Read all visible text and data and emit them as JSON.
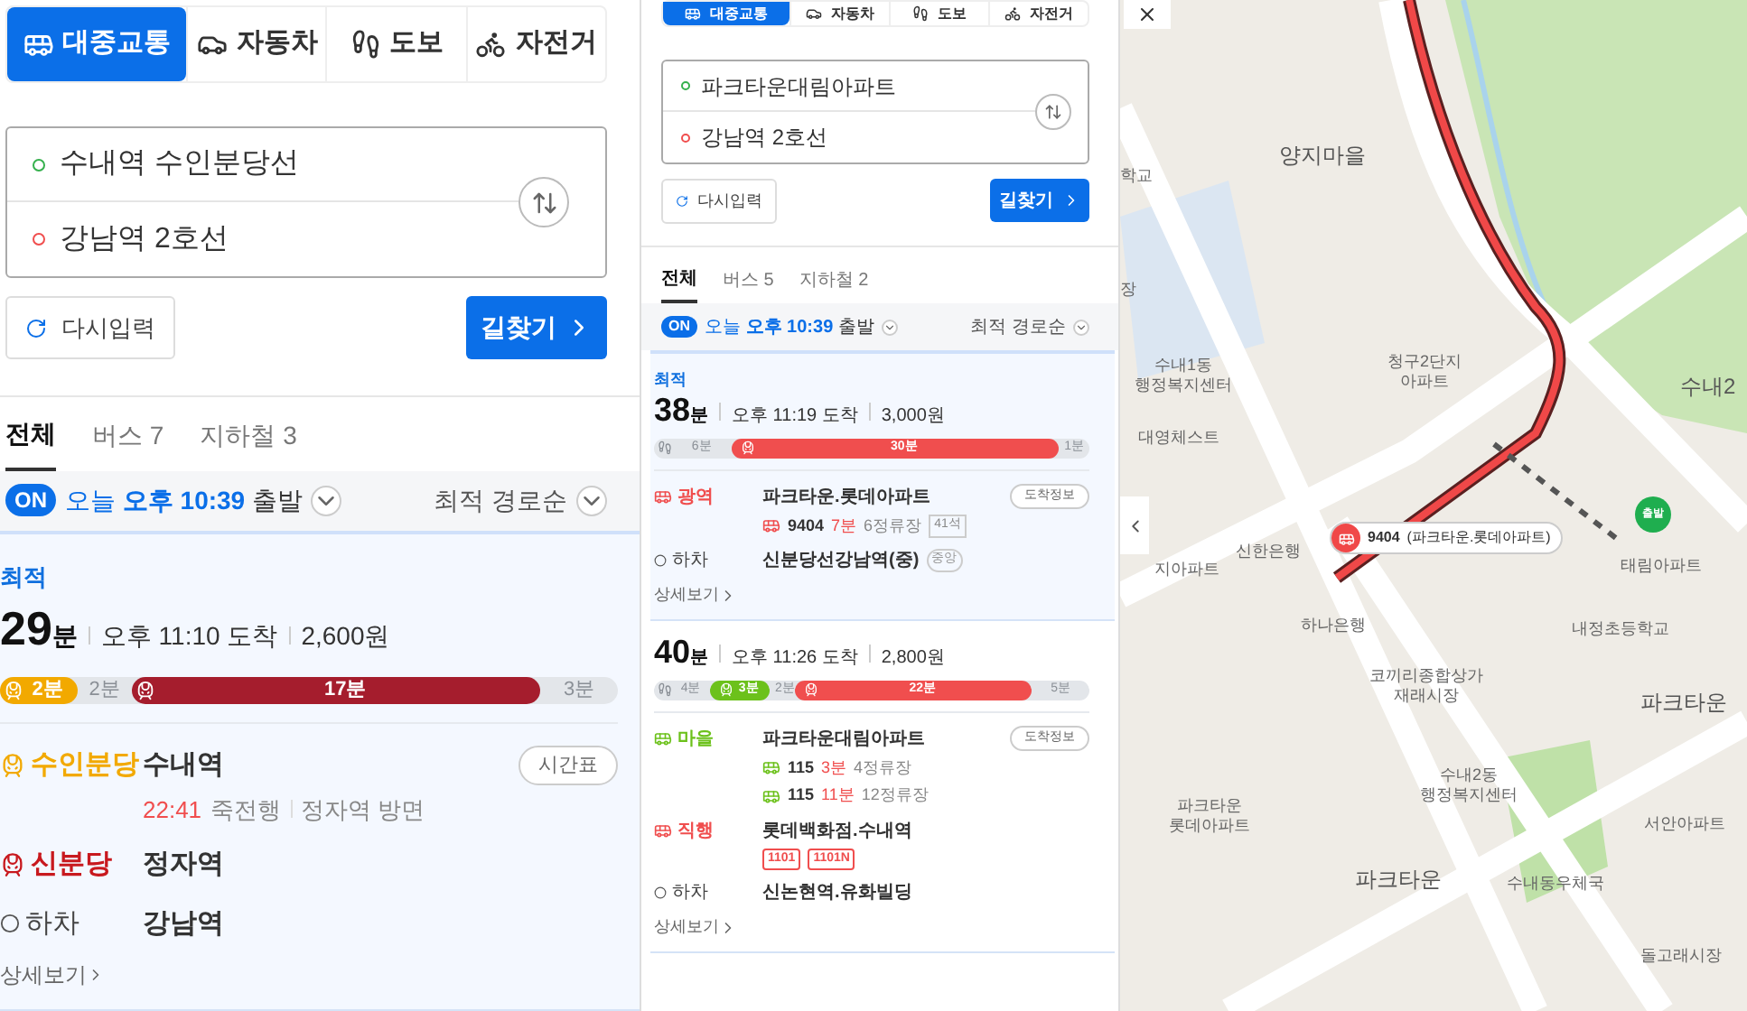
{
  "left_panel": {
    "mode_tabs": [
      {
        "kind": "transit",
        "label": "대중교통",
        "selected": true
      },
      {
        "kind": "car",
        "label": "자동차",
        "selected": false
      },
      {
        "kind": "walk",
        "label": "도보",
        "selected": false
      },
      {
        "kind": "bike",
        "label": "자전거",
        "selected": false
      }
    ],
    "origin": "수내역 수인분당선",
    "destination": "강남역 2호선",
    "reset_button": "다시입력",
    "search_button": "길찾기",
    "result_tabs": [
      {
        "label": "전체",
        "selected": true
      },
      {
        "label": "버스 7",
        "selected": false
      },
      {
        "label": "지하철 3",
        "selected": false
      }
    ],
    "departure": {
      "badge": "ON",
      "day": "오늘",
      "time": "오후 10:39",
      "suffix": "출발"
    },
    "sort": "최적 경로순",
    "routes": [
      {
        "selected": true,
        "badge": "최적",
        "duration": "29",
        "unit": "분",
        "arrival": "오후 11:10 도착",
        "fare": "2,600원",
        "segments": [
          {
            "kind": "ride",
            "color": "#f2a900",
            "label": "2분"
          },
          {
            "kind": "walk",
            "label": "2분"
          },
          {
            "kind": "ride",
            "color": "#a51d2d",
            "label": "17분"
          },
          {
            "kind": "walk",
            "label": "3분"
          }
        ],
        "steps": [
          {
            "kind": "subway",
            "color": "#f2a900",
            "line": "수인분당",
            "stop": "수내역",
            "button": "시간표",
            "info": {
              "time": "22:41",
              "direction": "죽전행",
              "platform": "정자역 방면"
            }
          },
          {
            "kind": "subway",
            "color": "#c8191e",
            "line": "신분당",
            "stop": "정자역"
          },
          {
            "kind": "alight",
            "line": "하차",
            "stop": "강남역"
          }
        ],
        "details_link": "상세보기"
      }
    ]
  },
  "middle_panel": {
    "mode_tabs": [
      {
        "kind": "transit",
        "label": "대중교통",
        "selected": true
      },
      {
        "kind": "car",
        "label": "자동차",
        "selected": false
      },
      {
        "kind": "walk",
        "label": "도보",
        "selected": false
      },
      {
        "kind": "bike",
        "label": "자전거",
        "selected": false
      }
    ],
    "origin": "파크타운대림아파트",
    "destination": "강남역 2호선",
    "reset_button": "다시입력",
    "search_button": "길찾기",
    "result_tabs": [
      {
        "label": "전체",
        "selected": true
      },
      {
        "label": "버스 5",
        "selected": false
      },
      {
        "label": "지하철 2",
        "selected": false
      }
    ],
    "departure": {
      "badge": "ON",
      "day": "오늘",
      "time": "오후 10:39",
      "suffix": "출발"
    },
    "sort": "최적 경로순",
    "routes": [
      {
        "selected": true,
        "badge": "최적",
        "duration": "38",
        "unit": "분",
        "arrival": "오후 11:19 도착",
        "fare": "3,000원",
        "segments": [
          {
            "kind": "walk",
            "icon": true,
            "label": "6분"
          },
          {
            "kind": "ride",
            "color": "#f04e4e",
            "label": "30분"
          },
          {
            "kind": "walk",
            "label": "1분"
          }
        ],
        "steps": [
          {
            "kind": "bus",
            "color": "#f04e4e",
            "line": "광역",
            "stop": "파크타운.롯데아파트",
            "button": "도착정보",
            "buses": [
              {
                "number": "9404",
                "eta": "7분",
                "stops": "6정류장",
                "seats": "41석"
              }
            ]
          },
          {
            "kind": "alight",
            "line": "하차",
            "stop": "신분당선강남역(중)",
            "tag": "중앙"
          }
        ],
        "details_link": "상세보기"
      },
      {
        "selected": false,
        "duration": "40",
        "unit": "분",
        "arrival": "오후 11:26 도착",
        "fare": "2,800원",
        "segments": [
          {
            "kind": "walk",
            "icon": true,
            "label": "4분"
          },
          {
            "kind": "ride",
            "color": "#6cc11b",
            "label": "3분"
          },
          {
            "kind": "walk",
            "label": "2분"
          },
          {
            "kind": "ride",
            "color": "#f04e4e",
            "label": "22분"
          },
          {
            "kind": "walk",
            "label": "5분"
          }
        ],
        "steps": [
          {
            "kind": "bus",
            "color": "#6cc11b",
            "line": "마을",
            "stop": "파크타운대림아파트",
            "button": "도착정보",
            "buses": [
              {
                "number": "115",
                "eta": "3분",
                "stops": "4정류장"
              },
              {
                "number": "115",
                "eta": "11분",
                "stops": "12정류장"
              }
            ]
          },
          {
            "kind": "bus",
            "color": "#f04e4e",
            "line": "직행",
            "stop": "롯데백화점.수내역",
            "route_tags": [
              "1101",
              "1101N"
            ]
          },
          {
            "kind": "alight",
            "line": "하차",
            "stop": "신논현역.유화빌딩"
          }
        ],
        "details_link": "상세보기"
      }
    ]
  },
  "map": {
    "labels": [
      {
        "kind": "area",
        "text": "양지마을"
      },
      {
        "kind": "poi",
        "text": "학교"
      },
      {
        "kind": "poi",
        "text": "장"
      },
      {
        "kind": "poi",
        "text": "수내1동\n행정복지센터"
      },
      {
        "kind": "poi",
        "text": "대영체스트"
      },
      {
        "kind": "poi",
        "text": "청구2단지\n아파트"
      },
      {
        "kind": "area",
        "text": "수내2"
      },
      {
        "kind": "poi",
        "text": "지아파트"
      },
      {
        "kind": "poi",
        "text": "신한은행"
      },
      {
        "kind": "poi",
        "text": "태림아파트"
      },
      {
        "kind": "poi",
        "text": "하나은행"
      },
      {
        "kind": "poi",
        "text": "내정초등학교"
      },
      {
        "kind": "poi",
        "text": "코끼리종합상가\n재래시장"
      },
      {
        "kind": "area",
        "text": "파크타운"
      },
      {
        "kind": "poi",
        "text": "수내2동\n행정복지센터"
      },
      {
        "kind": "poi",
        "text": "파크타운\n롯데아파트"
      },
      {
        "kind": "poi",
        "text": "서안아파트"
      },
      {
        "kind": "area",
        "text": "파크타운"
      },
      {
        "kind": "poi",
        "text": "수내동우체국"
      },
      {
        "kind": "poi",
        "text": "돌고래시장"
      }
    ],
    "callout": {
      "number": "9404",
      "stop": "(파크타운.롯데아파트)"
    },
    "start_pin": "출발"
  }
}
